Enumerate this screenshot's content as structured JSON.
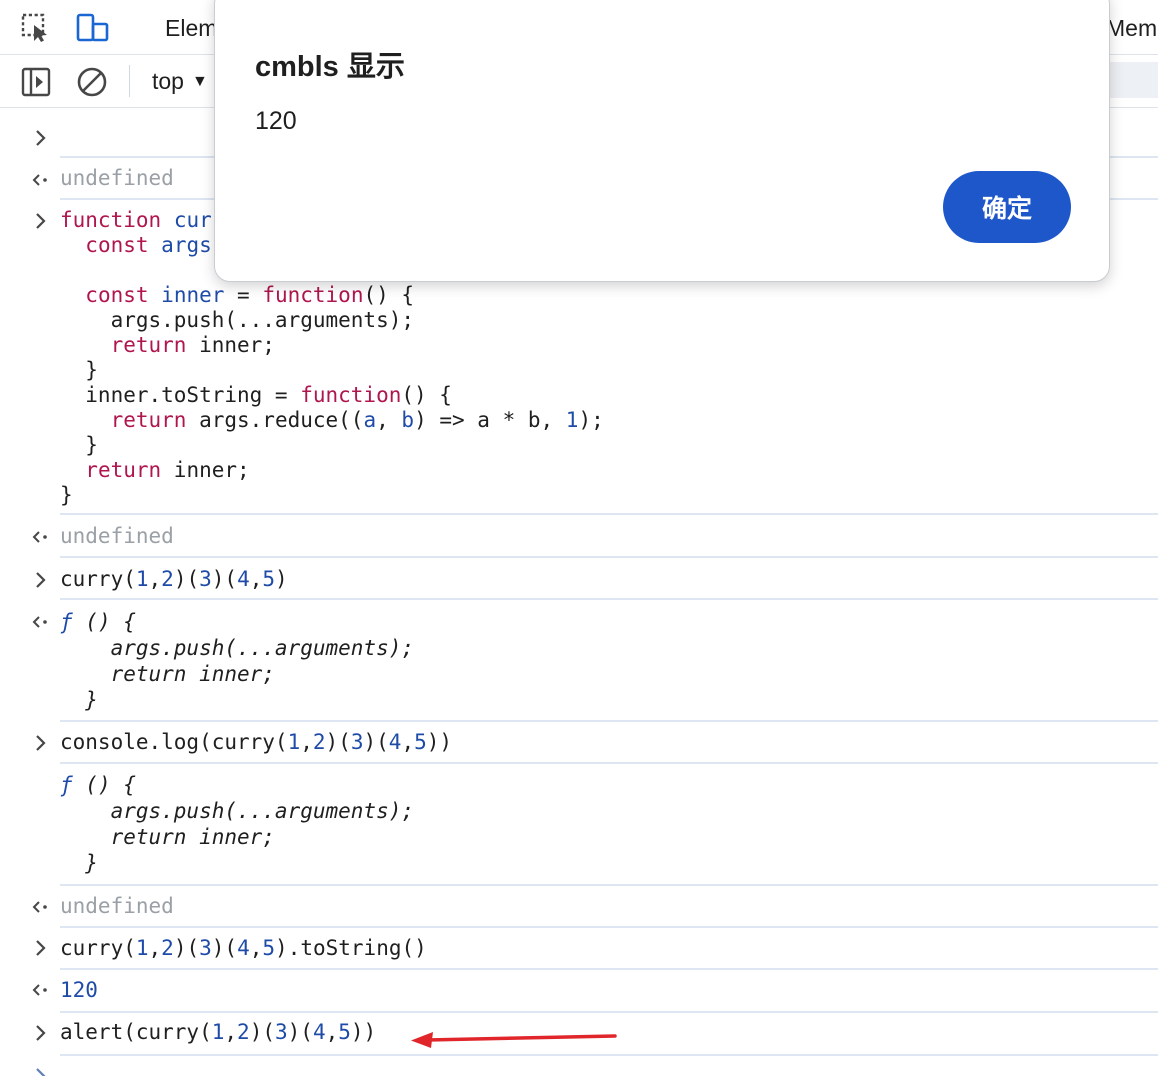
{
  "tabs": {
    "elements_label": "Elem",
    "memory_label": "Mem"
  },
  "toolbar": {
    "context_label": "top"
  },
  "icons": {
    "inspect": "inspect-element-icon",
    "device": "device-toolbar-icon",
    "sidebar": "sidebar-toggle-icon",
    "clear": "clear-console-icon",
    "caret": "caret-down-icon",
    "prompt": "chevron-right-icon",
    "result": "result-arrow-icon"
  },
  "colors": {
    "keyword": "#b0164e",
    "definition": "#1f4ba8",
    "number": "#1f4ba8",
    "muted": "#9aa0a6",
    "button": "#1d57c9",
    "annotation_arrow": "#e0262a"
  },
  "dialog": {
    "title": "cmbls 显示",
    "message": "120",
    "ok_label": "确定"
  },
  "console": {
    "lines": [
      {
        "tokens": []
      },
      {
        "tokens": [
          {
            "t": "gray",
            "v": "undefined"
          }
        ]
      },
      {
        "tokens": [
          {
            "t": "kw",
            "v": "function"
          },
          {
            "t": "plain",
            "v": " "
          },
          {
            "t": "def",
            "v": "cur"
          }
        ]
      },
      {
        "tokens": [
          {
            "t": "plain",
            "v": "  "
          },
          {
            "t": "kw",
            "v": "const"
          },
          {
            "t": "plain",
            "v": " "
          },
          {
            "t": "def",
            "v": "args"
          }
        ]
      },
      {
        "tokens": [
          {
            "t": "plain",
            "v": "  "
          },
          {
            "t": "kw",
            "v": "const"
          },
          {
            "t": "plain",
            "v": " "
          },
          {
            "t": "def",
            "v": "inner"
          },
          {
            "t": "plain",
            "v": " = "
          },
          {
            "t": "kw",
            "v": "function"
          },
          {
            "t": "plain",
            "v": "() {"
          }
        ]
      },
      {
        "tokens": [
          {
            "t": "plain",
            "v": "    args.push(...arguments);"
          }
        ]
      },
      {
        "tokens": [
          {
            "t": "plain",
            "v": "    "
          },
          {
            "t": "kw",
            "v": "return"
          },
          {
            "t": "plain",
            "v": " inner;"
          }
        ]
      },
      {
        "tokens": [
          {
            "t": "plain",
            "v": "  }"
          }
        ]
      },
      {
        "tokens": [
          {
            "t": "plain",
            "v": "  inner.toString = "
          },
          {
            "t": "kw",
            "v": "function"
          },
          {
            "t": "plain",
            "v": "() {"
          }
        ]
      },
      {
        "tokens": [
          {
            "t": "plain",
            "v": "    "
          },
          {
            "t": "kw",
            "v": "return"
          },
          {
            "t": "plain",
            "v": " args.reduce(("
          },
          {
            "t": "def",
            "v": "a"
          },
          {
            "t": "plain",
            "v": ", "
          },
          {
            "t": "def",
            "v": "b"
          },
          {
            "t": "plain",
            "v": ") => a * b, "
          },
          {
            "t": "num",
            "v": "1"
          },
          {
            "t": "plain",
            "v": ");"
          }
        ]
      },
      {
        "tokens": [
          {
            "t": "plain",
            "v": "  }"
          }
        ]
      },
      {
        "tokens": [
          {
            "t": "plain",
            "v": "  "
          },
          {
            "t": "kw",
            "v": "return"
          },
          {
            "t": "plain",
            "v": " inner;"
          }
        ]
      },
      {
        "tokens": [
          {
            "t": "plain",
            "v": "}"
          }
        ]
      },
      {
        "tokens": [
          {
            "t": "gray",
            "v": "undefined"
          }
        ]
      },
      {
        "tokens": [
          {
            "t": "plain",
            "v": "curry("
          },
          {
            "t": "num",
            "v": "1"
          },
          {
            "t": "plain",
            "v": ","
          },
          {
            "t": "num",
            "v": "2"
          },
          {
            "t": "plain",
            "v": ")("
          },
          {
            "t": "num",
            "v": "3"
          },
          {
            "t": "plain",
            "v": ")("
          },
          {
            "t": "num",
            "v": "4"
          },
          {
            "t": "plain",
            "v": ","
          },
          {
            "t": "num",
            "v": "5"
          },
          {
            "t": "plain",
            "v": ")"
          }
        ]
      },
      {
        "tokens": [
          {
            "t": "def",
            "v": "ƒ"
          },
          {
            "t": "plain",
            "v": " () {"
          }
        ]
      },
      {
        "tokens": [
          {
            "t": "plain",
            "v": "    args.push(...arguments);"
          }
        ]
      },
      {
        "tokens": [
          {
            "t": "plain",
            "v": "    return inner;"
          }
        ]
      },
      {
        "tokens": [
          {
            "t": "plain",
            "v": "  }"
          }
        ]
      },
      {
        "tokens": [
          {
            "t": "plain",
            "v": "console.log(curry("
          },
          {
            "t": "num",
            "v": "1"
          },
          {
            "t": "plain",
            "v": ","
          },
          {
            "t": "num",
            "v": "2"
          },
          {
            "t": "plain",
            "v": ")("
          },
          {
            "t": "num",
            "v": "3"
          },
          {
            "t": "plain",
            "v": ")("
          },
          {
            "t": "num",
            "v": "4"
          },
          {
            "t": "plain",
            "v": ","
          },
          {
            "t": "num",
            "v": "5"
          },
          {
            "t": "plain",
            "v": "))"
          }
        ]
      },
      {
        "tokens": [
          {
            "t": "def",
            "v": "ƒ"
          },
          {
            "t": "plain",
            "v": " () {"
          }
        ]
      },
      {
        "tokens": [
          {
            "t": "plain",
            "v": "    args.push(...arguments);"
          }
        ]
      },
      {
        "tokens": [
          {
            "t": "plain",
            "v": "    return inner;"
          }
        ]
      },
      {
        "tokens": [
          {
            "t": "plain",
            "v": "  }"
          }
        ]
      },
      {
        "tokens": [
          {
            "t": "gray",
            "v": "undefined"
          }
        ]
      },
      {
        "tokens": [
          {
            "t": "plain",
            "v": "curry("
          },
          {
            "t": "num",
            "v": "1"
          },
          {
            "t": "plain",
            "v": ","
          },
          {
            "t": "num",
            "v": "2"
          },
          {
            "t": "plain",
            "v": ")("
          },
          {
            "t": "num",
            "v": "3"
          },
          {
            "t": "plain",
            "v": ")("
          },
          {
            "t": "num",
            "v": "4"
          },
          {
            "t": "plain",
            "v": ","
          },
          {
            "t": "num",
            "v": "5"
          },
          {
            "t": "plain",
            "v": ").toString()"
          }
        ]
      },
      {
        "tokens": [
          {
            "t": "num",
            "v": "120"
          }
        ]
      },
      {
        "tokens": [
          {
            "t": "plain",
            "v": "alert(curry("
          },
          {
            "t": "num",
            "v": "1"
          },
          {
            "t": "plain",
            "v": ","
          },
          {
            "t": "num",
            "v": "2"
          },
          {
            "t": "plain",
            "v": ")("
          },
          {
            "t": "num",
            "v": "3"
          },
          {
            "t": "plain",
            "v": ")("
          },
          {
            "t": "num",
            "v": "4"
          },
          {
            "t": "plain",
            "v": ","
          },
          {
            "t": "num",
            "v": "5"
          },
          {
            "t": "plain",
            "v": "))"
          }
        ]
      }
    ]
  }
}
